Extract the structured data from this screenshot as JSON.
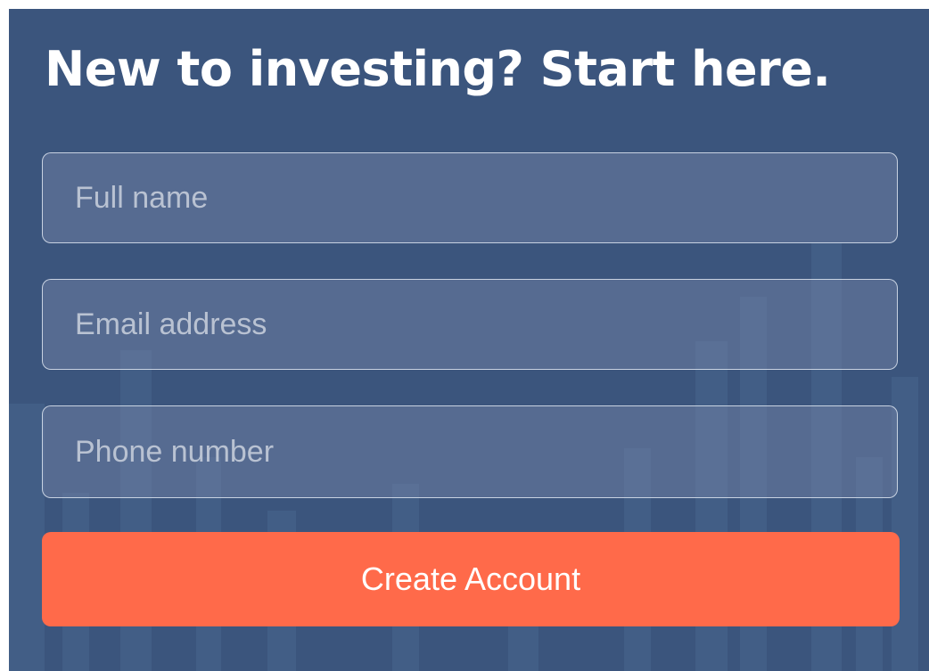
{
  "form": {
    "headline": "New to investing? Start here.",
    "fields": {
      "full_name_placeholder": "Full name",
      "email_placeholder": "Email address",
      "phone_placeholder": "Phone number"
    },
    "submit_label": "Create Account"
  },
  "colors": {
    "panel_background": "#3b557d",
    "button_accent": "#ff6a4a"
  }
}
